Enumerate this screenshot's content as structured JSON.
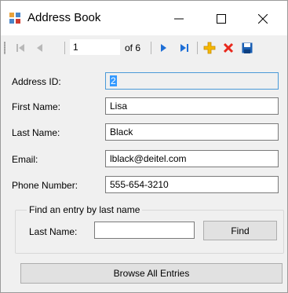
{
  "window": {
    "title": "Address Book",
    "icon": "address-book-icon"
  },
  "navigator": {
    "position": "1",
    "count_label": "of 6",
    "icons": [
      "move-first-icon",
      "move-previous-icon",
      "move-next-icon",
      "move-last-icon",
      "add-new-icon",
      "delete-icon",
      "save-icon"
    ],
    "colors": {
      "nav": "#1e6fd6",
      "add": "#f5b800",
      "delete": "#e8281c",
      "save": "#1a5fb4"
    }
  },
  "form": {
    "address_id": {
      "label": "Address ID:",
      "value": "2"
    },
    "first_name": {
      "label": "First Name:",
      "value": "Lisa"
    },
    "last_name": {
      "label": "Last Name:",
      "value": "Black"
    },
    "email": {
      "label": "Email:",
      "value": "lblack@deitel.com"
    },
    "phone": {
      "label": "Phone Number:",
      "value": "555-654-3210"
    }
  },
  "search": {
    "group_title": "Find an entry by last name",
    "last_name_label": "Last Name:",
    "last_name_value": "",
    "find_label": "Find"
  },
  "browse_label": "Browse All Entries"
}
